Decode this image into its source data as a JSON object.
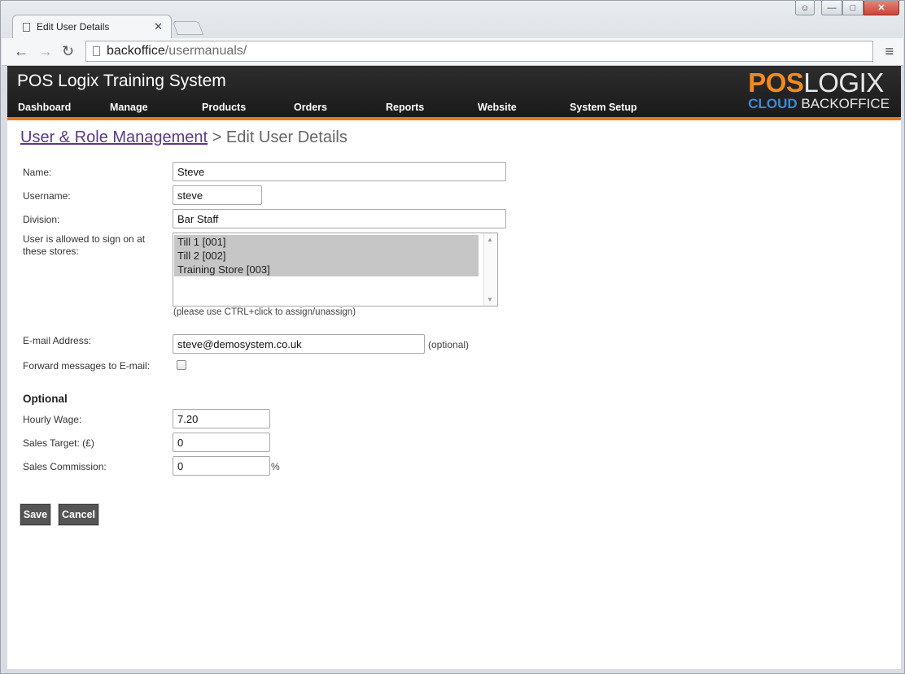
{
  "browser": {
    "tab_title": "Edit User Details",
    "url_host": "backoffice",
    "url_path": "/usermanuals/"
  },
  "header": {
    "system_title": "POS Logix Training System",
    "logo": {
      "pos": "POS",
      "logix": "LOGIX",
      "cloud": "CLOUD",
      "backoffice": "BACKOFFICE"
    },
    "accent_color": "#e77a1e",
    "nav": [
      "Dashboard",
      "Manage",
      "Products",
      "Orders",
      "Reports",
      "Website",
      "System Setup"
    ]
  },
  "breadcrumb": {
    "link": "User & Role Management",
    "separator": " > ",
    "current": "Edit User Details"
  },
  "form": {
    "name_label": "Name:",
    "name_value": "Steve",
    "username_label": "Username:",
    "username_value": "steve",
    "division_label": "Division:",
    "division_value": "Bar Staff",
    "stores_label": "User is allowed to sign on at these stores:",
    "stores": [
      "Till 1 [001]",
      "Till 2 [002]",
      "Training Store [003]"
    ],
    "stores_hint": "(please use CTRL+click to assign/unassign)",
    "email_label": "E-mail Address:",
    "email_value": "steve@demosystem.co.uk",
    "email_note": "(optional)",
    "forward_label": "Forward messages to E-mail:",
    "forward_checked": false,
    "optional_heading": "Optional",
    "wage_label": "Hourly Wage:",
    "wage_value": "7.20",
    "sales_target_label": "Sales Target: (£)",
    "sales_target_value": "0",
    "commission_label": "Sales Commission:",
    "commission_value": "0",
    "commission_unit": "%"
  },
  "buttons": {
    "save": "Save",
    "cancel": "Cancel"
  }
}
